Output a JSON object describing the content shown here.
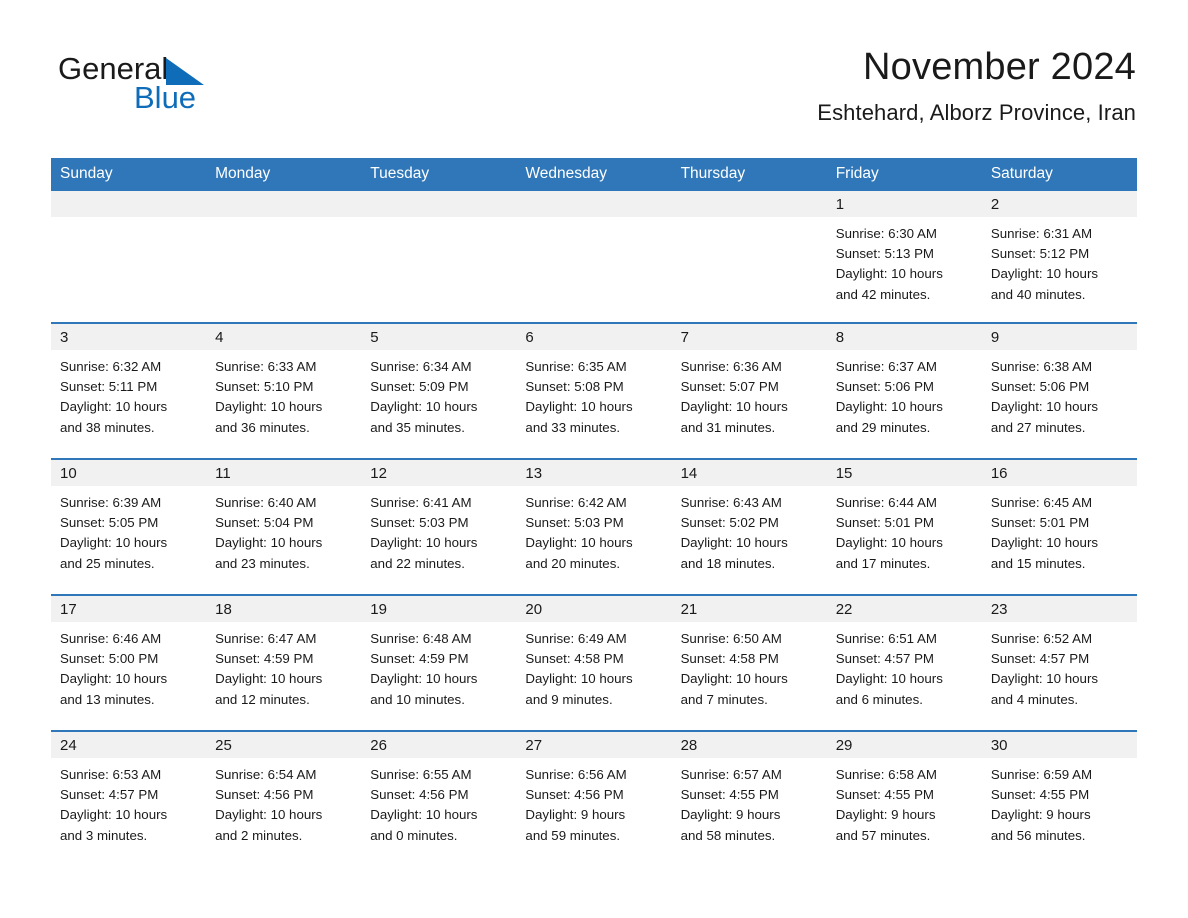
{
  "brand": {
    "name_part1": "General",
    "name_part2": "Blue",
    "triangle_color": "#0f6cb8",
    "text_color": "#1a1a1a"
  },
  "header": {
    "title": "November 2024",
    "subtitle": "Eshtehard, Alborz Province, Iran"
  },
  "theme": {
    "header_blue": "#2f77b8",
    "daynum_strip": "#f1f1f1",
    "text": "#1a1a1a",
    "background": "#ffffff"
  },
  "weekday_headers": [
    "Sunday",
    "Monday",
    "Tuesday",
    "Wednesday",
    "Thursday",
    "Friday",
    "Saturday"
  ],
  "weeks": [
    [
      {
        "day": "",
        "sunrise": "",
        "sunset": "",
        "daylight_line1": "",
        "daylight_line2": ""
      },
      {
        "day": "",
        "sunrise": "",
        "sunset": "",
        "daylight_line1": "",
        "daylight_line2": ""
      },
      {
        "day": "",
        "sunrise": "",
        "sunset": "",
        "daylight_line1": "",
        "daylight_line2": ""
      },
      {
        "day": "",
        "sunrise": "",
        "sunset": "",
        "daylight_line1": "",
        "daylight_line2": ""
      },
      {
        "day": "",
        "sunrise": "",
        "sunset": "",
        "daylight_line1": "",
        "daylight_line2": ""
      },
      {
        "day": "1",
        "sunrise": "Sunrise: 6:30 AM",
        "sunset": "Sunset: 5:13 PM",
        "daylight_line1": "Daylight: 10 hours",
        "daylight_line2": "and 42 minutes."
      },
      {
        "day": "2",
        "sunrise": "Sunrise: 6:31 AM",
        "sunset": "Sunset: 5:12 PM",
        "daylight_line1": "Daylight: 10 hours",
        "daylight_line2": "and 40 minutes."
      }
    ],
    [
      {
        "day": "3",
        "sunrise": "Sunrise: 6:32 AM",
        "sunset": "Sunset: 5:11 PM",
        "daylight_line1": "Daylight: 10 hours",
        "daylight_line2": "and 38 minutes."
      },
      {
        "day": "4",
        "sunrise": "Sunrise: 6:33 AM",
        "sunset": "Sunset: 5:10 PM",
        "daylight_line1": "Daylight: 10 hours",
        "daylight_line2": "and 36 minutes."
      },
      {
        "day": "5",
        "sunrise": "Sunrise: 6:34 AM",
        "sunset": "Sunset: 5:09 PM",
        "daylight_line1": "Daylight: 10 hours",
        "daylight_line2": "and 35 minutes."
      },
      {
        "day": "6",
        "sunrise": "Sunrise: 6:35 AM",
        "sunset": "Sunset: 5:08 PM",
        "daylight_line1": "Daylight: 10 hours",
        "daylight_line2": "and 33 minutes."
      },
      {
        "day": "7",
        "sunrise": "Sunrise: 6:36 AM",
        "sunset": "Sunset: 5:07 PM",
        "daylight_line1": "Daylight: 10 hours",
        "daylight_line2": "and 31 minutes."
      },
      {
        "day": "8",
        "sunrise": "Sunrise: 6:37 AM",
        "sunset": "Sunset: 5:06 PM",
        "daylight_line1": "Daylight: 10 hours",
        "daylight_line2": "and 29 minutes."
      },
      {
        "day": "9",
        "sunrise": "Sunrise: 6:38 AM",
        "sunset": "Sunset: 5:06 PM",
        "daylight_line1": "Daylight: 10 hours",
        "daylight_line2": "and 27 minutes."
      }
    ],
    [
      {
        "day": "10",
        "sunrise": "Sunrise: 6:39 AM",
        "sunset": "Sunset: 5:05 PM",
        "daylight_line1": "Daylight: 10 hours",
        "daylight_line2": "and 25 minutes."
      },
      {
        "day": "11",
        "sunrise": "Sunrise: 6:40 AM",
        "sunset": "Sunset: 5:04 PM",
        "daylight_line1": "Daylight: 10 hours",
        "daylight_line2": "and 23 minutes."
      },
      {
        "day": "12",
        "sunrise": "Sunrise: 6:41 AM",
        "sunset": "Sunset: 5:03 PM",
        "daylight_line1": "Daylight: 10 hours",
        "daylight_line2": "and 22 minutes."
      },
      {
        "day": "13",
        "sunrise": "Sunrise: 6:42 AM",
        "sunset": "Sunset: 5:03 PM",
        "daylight_line1": "Daylight: 10 hours",
        "daylight_line2": "and 20 minutes."
      },
      {
        "day": "14",
        "sunrise": "Sunrise: 6:43 AM",
        "sunset": "Sunset: 5:02 PM",
        "daylight_line1": "Daylight: 10 hours",
        "daylight_line2": "and 18 minutes."
      },
      {
        "day": "15",
        "sunrise": "Sunrise: 6:44 AM",
        "sunset": "Sunset: 5:01 PM",
        "daylight_line1": "Daylight: 10 hours",
        "daylight_line2": "and 17 minutes."
      },
      {
        "day": "16",
        "sunrise": "Sunrise: 6:45 AM",
        "sunset": "Sunset: 5:01 PM",
        "daylight_line1": "Daylight: 10 hours",
        "daylight_line2": "and 15 minutes."
      }
    ],
    [
      {
        "day": "17",
        "sunrise": "Sunrise: 6:46 AM",
        "sunset": "Sunset: 5:00 PM",
        "daylight_line1": "Daylight: 10 hours",
        "daylight_line2": "and 13 minutes."
      },
      {
        "day": "18",
        "sunrise": "Sunrise: 6:47 AM",
        "sunset": "Sunset: 4:59 PM",
        "daylight_line1": "Daylight: 10 hours",
        "daylight_line2": "and 12 minutes."
      },
      {
        "day": "19",
        "sunrise": "Sunrise: 6:48 AM",
        "sunset": "Sunset: 4:59 PM",
        "daylight_line1": "Daylight: 10 hours",
        "daylight_line2": "and 10 minutes."
      },
      {
        "day": "20",
        "sunrise": "Sunrise: 6:49 AM",
        "sunset": "Sunset: 4:58 PM",
        "daylight_line1": "Daylight: 10 hours",
        "daylight_line2": "and 9 minutes."
      },
      {
        "day": "21",
        "sunrise": "Sunrise: 6:50 AM",
        "sunset": "Sunset: 4:58 PM",
        "daylight_line1": "Daylight: 10 hours",
        "daylight_line2": "and 7 minutes."
      },
      {
        "day": "22",
        "sunrise": "Sunrise: 6:51 AM",
        "sunset": "Sunset: 4:57 PM",
        "daylight_line1": "Daylight: 10 hours",
        "daylight_line2": "and 6 minutes."
      },
      {
        "day": "23",
        "sunrise": "Sunrise: 6:52 AM",
        "sunset": "Sunset: 4:57 PM",
        "daylight_line1": "Daylight: 10 hours",
        "daylight_line2": "and 4 minutes."
      }
    ],
    [
      {
        "day": "24",
        "sunrise": "Sunrise: 6:53 AM",
        "sunset": "Sunset: 4:57 PM",
        "daylight_line1": "Daylight: 10 hours",
        "daylight_line2": "and 3 minutes."
      },
      {
        "day": "25",
        "sunrise": "Sunrise: 6:54 AM",
        "sunset": "Sunset: 4:56 PM",
        "daylight_line1": "Daylight: 10 hours",
        "daylight_line2": "and 2 minutes."
      },
      {
        "day": "26",
        "sunrise": "Sunrise: 6:55 AM",
        "sunset": "Sunset: 4:56 PM",
        "daylight_line1": "Daylight: 10 hours",
        "daylight_line2": "and 0 minutes."
      },
      {
        "day": "27",
        "sunrise": "Sunrise: 6:56 AM",
        "sunset": "Sunset: 4:56 PM",
        "daylight_line1": "Daylight: 9 hours",
        "daylight_line2": "and 59 minutes."
      },
      {
        "day": "28",
        "sunrise": "Sunrise: 6:57 AM",
        "sunset": "Sunset: 4:55 PM",
        "daylight_line1": "Daylight: 9 hours",
        "daylight_line2": "and 58 minutes."
      },
      {
        "day": "29",
        "sunrise": "Sunrise: 6:58 AM",
        "sunset": "Sunset: 4:55 PM",
        "daylight_line1": "Daylight: 9 hours",
        "daylight_line2": "and 57 minutes."
      },
      {
        "day": "30",
        "sunrise": "Sunrise: 6:59 AM",
        "sunset": "Sunset: 4:55 PM",
        "daylight_line1": "Daylight: 9 hours",
        "daylight_line2": "and 56 minutes."
      }
    ]
  ]
}
